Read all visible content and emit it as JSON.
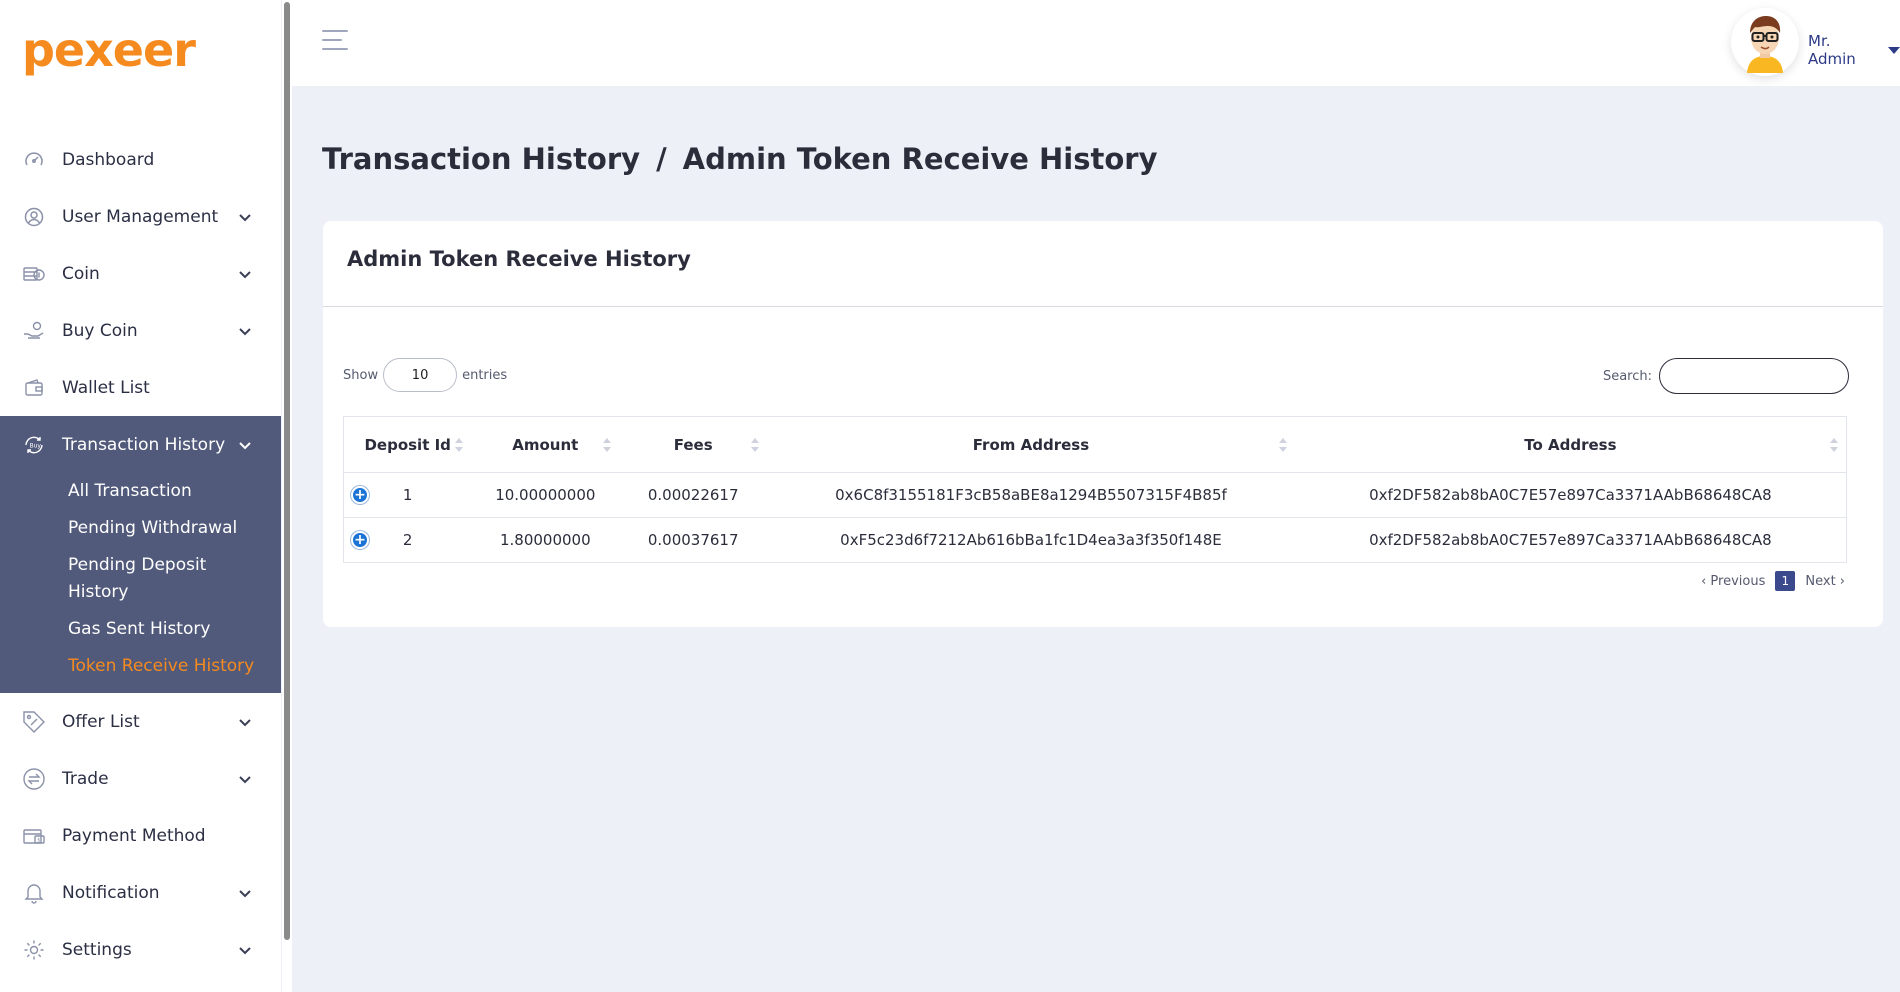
{
  "brand": {
    "logo_text": "pexeer",
    "accent": "#f58a1f"
  },
  "sidebar": {
    "items": [
      {
        "label": "Dashboard",
        "icon": "gauge-icon",
        "has_children": false
      },
      {
        "label": "User Management",
        "icon": "user-circle-icon",
        "has_children": true
      },
      {
        "label": "Coin",
        "icon": "coin-stack-icon",
        "has_children": true
      },
      {
        "label": "Buy Coin",
        "icon": "hand-coin-icon",
        "has_children": true
      },
      {
        "label": "Wallet List",
        "icon": "wallet-icon",
        "has_children": false
      },
      {
        "label": "Transaction History",
        "icon": "transaction-icon",
        "has_children": true,
        "active": true
      },
      {
        "label": "Offer List",
        "icon": "offer-tag-icon",
        "has_children": true
      },
      {
        "label": "Trade",
        "icon": "trade-arrows-icon",
        "has_children": true
      },
      {
        "label": "Payment Method",
        "icon": "payment-card-icon",
        "has_children": false
      },
      {
        "label": "Notification",
        "icon": "bell-icon",
        "has_children": true
      },
      {
        "label": "Settings",
        "icon": "gear-icon",
        "has_children": true
      }
    ],
    "submenu": [
      {
        "label": "All Transaction"
      },
      {
        "label": "Pending Withdrawal"
      },
      {
        "label": "Pending Deposit History"
      },
      {
        "label": "Gas Sent History"
      },
      {
        "label": "Token Receive History",
        "current": true
      }
    ]
  },
  "topbar": {
    "user_name": "Mr. Admin"
  },
  "breadcrumb": {
    "parent": "Transaction History",
    "separator": "/",
    "current": "Admin Token Receive History"
  },
  "card": {
    "title": "Admin Token Receive History"
  },
  "table_controls": {
    "show_label": "Show",
    "entries_value": "10",
    "entries_label": "entries",
    "search_label": "Search:",
    "search_value": ""
  },
  "table": {
    "columns": [
      "Deposit Id",
      "Amount",
      "Fees",
      "From Address",
      "To Address"
    ],
    "rows": [
      {
        "id": "1",
        "amount": "10.00000000",
        "fees": "0.00022617",
        "from": "0x6C8f3155181F3cB58aBE8a1294B5507315F4B85f",
        "to": "0xf2DF582ab8bA0C7E57e897Ca3371AAbB68648CA8"
      },
      {
        "id": "2",
        "amount": "1.80000000",
        "fees": "0.00037617",
        "from": "0xF5c23d6f7212Ab616bBa1fc1D4ea3a3f350f148E",
        "to": "0xf2DF582ab8bA0C7E57e897Ca3371AAbB68648CA8"
      }
    ]
  },
  "pagination": {
    "previous": "‹ Previous",
    "current_page": "1",
    "next": "Next ›"
  }
}
